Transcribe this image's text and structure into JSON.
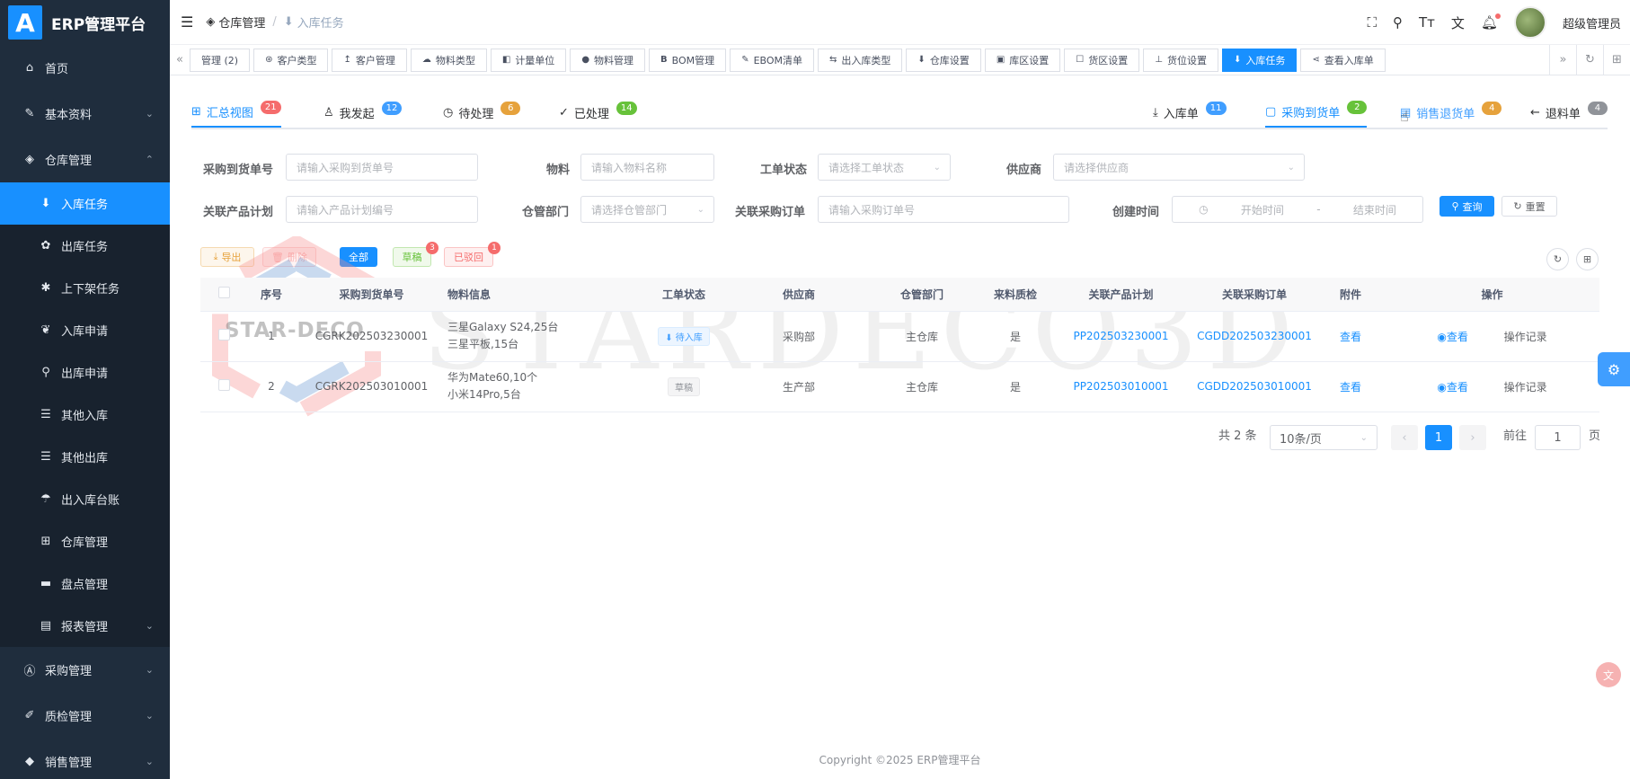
{
  "app": {
    "logo_letter": "A",
    "title": "ERP管理平台"
  },
  "sidebar": {
    "items": [
      {
        "label": "首页",
        "icon": "home-icon"
      },
      {
        "label": "基本资料",
        "icon": "edit-icon"
      },
      {
        "label": "仓库管理",
        "icon": "cube-icon"
      },
      {
        "label": "采购管理",
        "icon": "a-box-icon"
      },
      {
        "label": "质检管理",
        "icon": "brush-icon"
      },
      {
        "label": "销售管理",
        "icon": "sale-icon"
      }
    ],
    "sub_items": [
      {
        "label": "入库任务"
      },
      {
        "label": "出库任务"
      },
      {
        "label": "上下架任务"
      },
      {
        "label": "入库申请"
      },
      {
        "label": "出库申请"
      },
      {
        "label": "其他入库"
      },
      {
        "label": "其他出库"
      },
      {
        "label": "出入库台账"
      },
      {
        "label": "仓库管理"
      },
      {
        "label": "盘点管理"
      },
      {
        "label": "报表管理"
      }
    ]
  },
  "header": {
    "breadcrumb": [
      "仓库管理",
      "入库任务"
    ],
    "user_name": "超级管理员"
  },
  "tags": [
    "管理 (2)",
    "客户类型",
    "客户管理",
    "物料类型",
    "计量单位",
    "物料管理",
    "BOM管理",
    "EBOM清单",
    "出入库类型",
    "仓库设置",
    "库区设置",
    "货区设置",
    "货位设置",
    "入库任务",
    "查看入库单"
  ],
  "tabs_left": [
    {
      "label": "汇总视图",
      "badge": "21"
    },
    {
      "label": "我发起",
      "badge": "12"
    },
    {
      "label": "待处理",
      "badge": "6"
    },
    {
      "label": "已处理",
      "badge": "14"
    }
  ],
  "tabs_right": [
    {
      "label": "入库单",
      "badge": "11"
    },
    {
      "label": "采购到货单",
      "badge": "2"
    },
    {
      "label": "销售退货单",
      "badge": "4"
    },
    {
      "label": "退料单",
      "badge": "4"
    }
  ],
  "form": {
    "labels": {
      "arrival_no": "采购到货单号",
      "material": "物料",
      "status": "工单状态",
      "supplier": "供应商",
      "plan": "关联产品计划",
      "dept": "仓管部门",
      "po": "关联采购订单",
      "created": "创建时间"
    },
    "placeholders": {
      "arrival_no": "请输入采购到货单号",
      "material": "请输入物料名称",
      "status": "请选择工单状态",
      "supplier": "请选择供应商",
      "plan": "请输入产品计划编号",
      "dept": "请选择仓管部门",
      "po": "请输入采购订单号",
      "start": "开始时间",
      "end": "结束时间",
      "range_sep": "-"
    },
    "query": "查询",
    "reset": "重置"
  },
  "toolbar": {
    "export": "导出",
    "delete": "删除",
    "all": "全部",
    "draft": "草稿",
    "draft_count": "3",
    "returned": "已驳回",
    "returned_count": "1"
  },
  "table": {
    "headers": [
      "序号",
      "采购到货单号",
      "物料信息",
      "工单状态",
      "供应商",
      "仓管部门",
      "来料质检",
      "关联产品计划",
      "关联采购订单",
      "附件",
      "操作"
    ],
    "rows": [
      {
        "no": "1",
        "arrival_no": "CGRK202503230001",
        "material_1": "三星Galaxy S24,25台",
        "material_2": "三星平板,15台",
        "status": "待入库",
        "supplier": "采购部",
        "dept": "主仓库",
        "qc": "是",
        "plan": "PP202503230001",
        "po": "CGDD202503230001",
        "attach": "查看",
        "view": "查看",
        "log": "操作记录"
      },
      {
        "no": "2",
        "arrival_no": "CGRK202503010001",
        "material_1": "华为Mate60,10个",
        "material_2": "小米14Pro,5台",
        "status": "草稿",
        "supplier": "生产部",
        "dept": "主仓库",
        "qc": "是",
        "plan": "PP202503010001",
        "po": "CGDD202503010001",
        "attach": "查看",
        "view": "查看",
        "log": "操作记录"
      }
    ]
  },
  "pagination": {
    "total": "共 2 条",
    "page_size": "10条/页",
    "current": "1",
    "goto_label": "前往",
    "goto_value": "1",
    "page_unit": "页"
  },
  "footer": "Copyright ©2025 ERP管理平台",
  "watermark": {
    "big": "STARDECO3D",
    "small": "STAR-DECO"
  },
  "colors": {
    "primary": "#1890ff",
    "sidebar": "#1f2d3d",
    "danger": "#f56c6c",
    "warning": "#e6a23c",
    "success": "#67c23a"
  }
}
